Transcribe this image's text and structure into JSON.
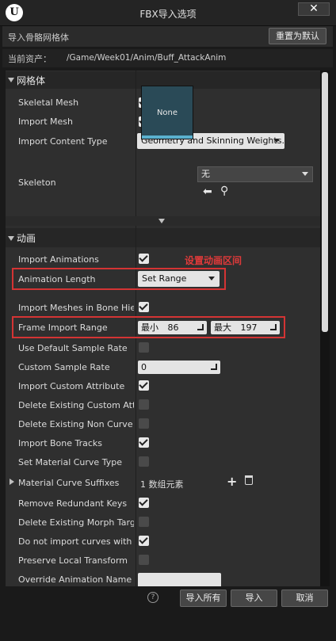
{
  "window": {
    "title": "FBX导入选项",
    "close_glyph": "✕",
    "logo_text": "U"
  },
  "header": {
    "label": "导入骨骼网格体",
    "reset_button": "重置为默认"
  },
  "asset": {
    "label": "当前资产：",
    "path": "/Game/Week01/Anim/Buff_AttackAnim"
  },
  "mesh_section": {
    "title": "网格体",
    "skeletal_mesh": {
      "label": "Skeletal Mesh",
      "checked": true
    },
    "import_mesh": {
      "label": "Import Mesh",
      "checked": true
    },
    "import_content_type": {
      "label": "Import Content Type",
      "value": "Geometry and Skinning Weights."
    },
    "skeleton": {
      "label": "Skeleton",
      "thumb_text": "None",
      "value": "无"
    }
  },
  "anim_section": {
    "title": "动画",
    "annotation": "设置动画区间",
    "rows": [
      {
        "key": "import_animations",
        "label": "Import Animations",
        "type": "checkbox",
        "checked": true
      },
      {
        "key": "animation_length",
        "label": "Animation Length",
        "type": "combo",
        "value": "Set Range"
      },
      {
        "key": "import_meshes_in_bone_hierarchy",
        "label": "Import Meshes in Bone Hiera",
        "type": "checkbox",
        "checked": true
      },
      {
        "key": "frame_import_range",
        "label": "Frame Import Range",
        "type": "range",
        "min_label": "最小",
        "min_value": "86",
        "max_label": "最大",
        "max_value": "197"
      },
      {
        "key": "use_default_sample_rate",
        "label": "Use Default Sample Rate",
        "type": "checkbox",
        "checked": false
      },
      {
        "key": "custom_sample_rate",
        "label": "Custom Sample Rate",
        "type": "number",
        "value": "0"
      },
      {
        "key": "import_custom_attribute",
        "label": "Import Custom Attribute",
        "type": "checkbox",
        "checked": true
      },
      {
        "key": "delete_existing_custom_attributes",
        "label": "Delete Existing Custom Attrib",
        "type": "checkbox",
        "checked": false
      },
      {
        "key": "delete_existing_non_curve_custom",
        "label": "Delete Existing Non Curve Cu",
        "type": "checkbox",
        "checked": false
      },
      {
        "key": "import_bone_tracks",
        "label": "Import Bone Tracks",
        "type": "checkbox",
        "checked": true
      },
      {
        "key": "set_material_curve_type",
        "label": "Set Material Curve Type",
        "type": "checkbox",
        "checked": false
      },
      {
        "key": "material_curve_suffixes",
        "label": "Material Curve Suffixes",
        "type": "array",
        "value": "1 数组元素"
      },
      {
        "key": "remove_redundant_keys",
        "label": "Remove Redundant Keys",
        "type": "checkbox",
        "checked": true
      },
      {
        "key": "delete_existing_morph_target",
        "label": "Delete Existing Morph Target",
        "type": "checkbox",
        "checked": false
      },
      {
        "key": "do_not_import_curves_with_only_zero",
        "label": "Do not import curves with onl",
        "type": "checkbox",
        "checked": true
      },
      {
        "key": "preserve_local_transform",
        "label": "Preserve Local Transform",
        "type": "checkbox",
        "checked": false
      },
      {
        "key": "override_animation_name",
        "label": "Override Animation Name",
        "type": "text",
        "value": ""
      }
    ]
  },
  "footer": {
    "help_glyph": "?",
    "import_all": "导入所有",
    "import": "导入",
    "cancel": "取消"
  }
}
